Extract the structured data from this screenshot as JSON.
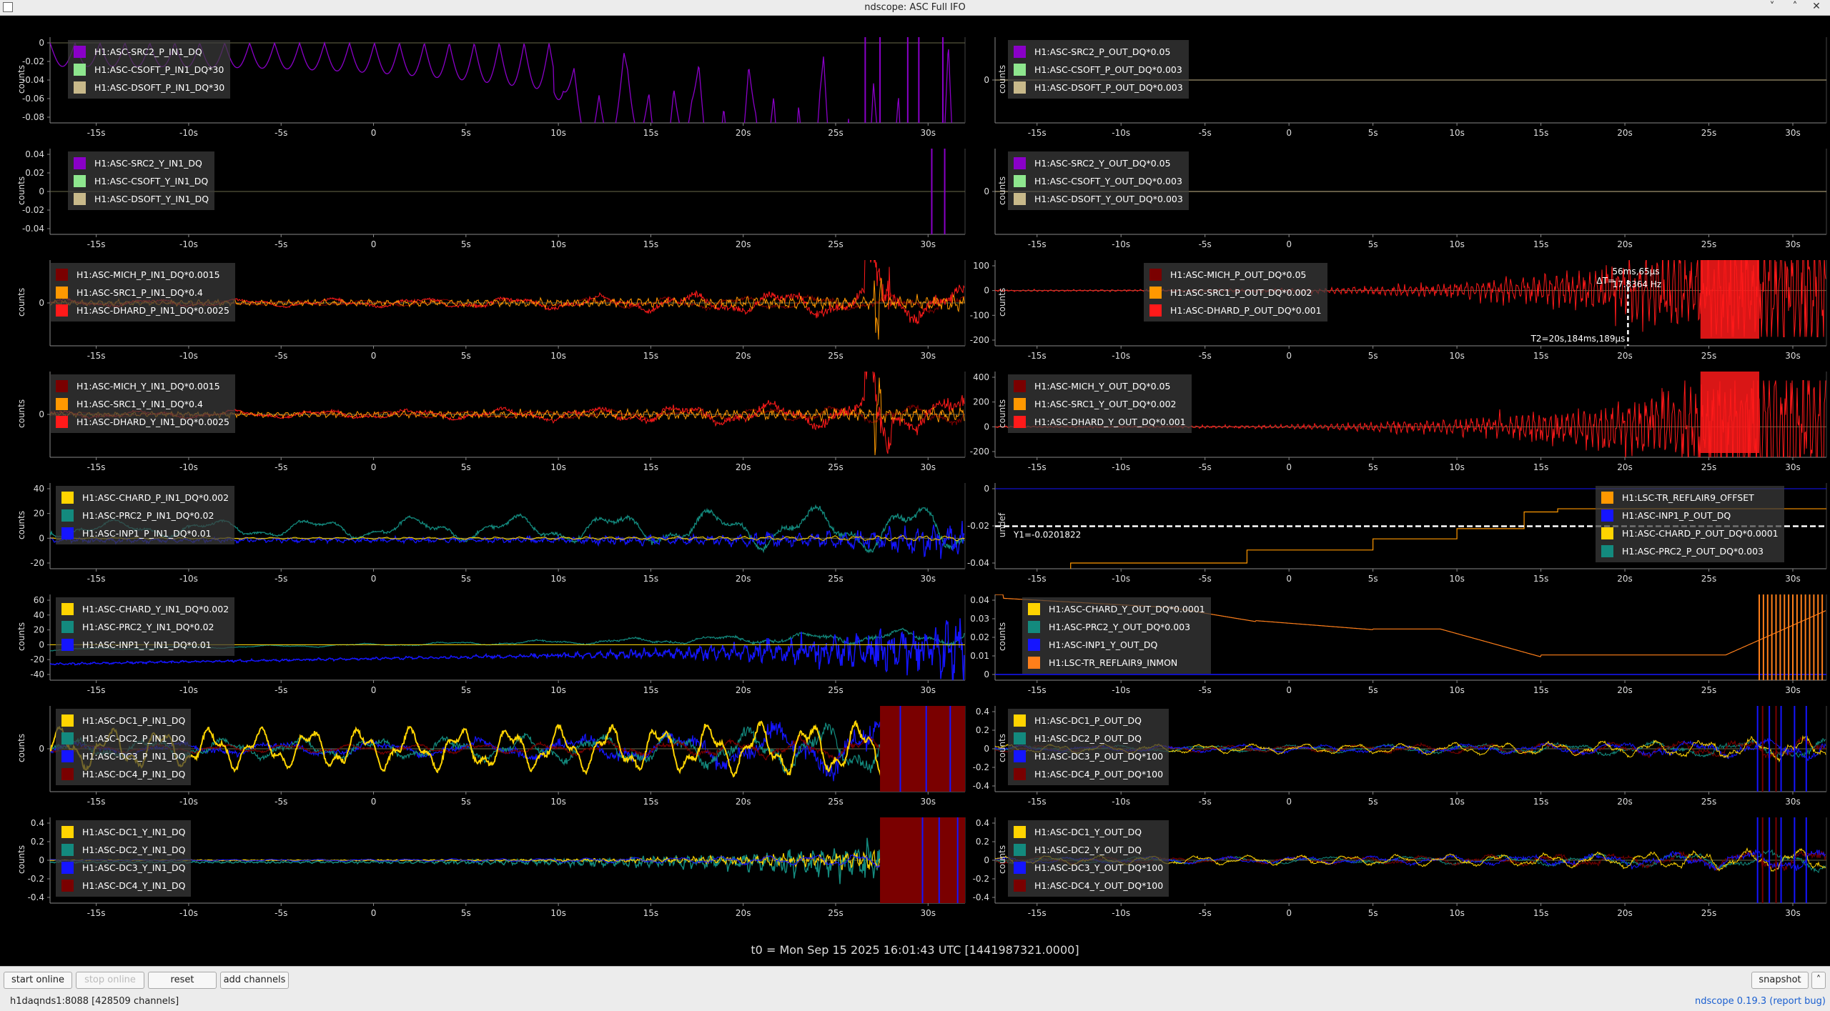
{
  "window": {
    "title": "ndscope: ASC Full IFO",
    "minimize_icon": "chevron-down-icon",
    "maximize_icon": "chevron-up-icon",
    "close_icon": "close-icon"
  },
  "time_axis": {
    "ticks": [
      "-15s",
      "-10s",
      "-5s",
      "0",
      "5s",
      "10s",
      "15s",
      "20s",
      "25s",
      "30s"
    ],
    "range": [
      -17.5,
      32
    ]
  },
  "t0_label": "t0 = Mon Sep 15 2025 16:01:43 UTC [1441987321.0000]",
  "colors": {
    "purple": "#8a00c8",
    "light_green": "#8ee68e",
    "khaki": "#c8b98a",
    "dark_red": "#7a0000",
    "orange": "#ff9800",
    "red": "#ff1a1a",
    "yellow": "#ffd400",
    "teal": "#138a7e",
    "blue": "#1515ff",
    "dark_orange": "#ff7f1a",
    "cursor": "#ffffff"
  },
  "panels": [
    {
      "id": "l1",
      "ylabel": "counts",
      "yticks": [
        "0",
        "-0.02",
        "-0.04",
        "-0.06",
        "-0.08"
      ],
      "legend": [
        {
          "label": "H1:ASC-SRC2_P_IN1_DQ",
          "color": "#8a00c8"
        },
        {
          "label": "H1:ASC-CSOFT_P_IN1_DQ*30",
          "color": "#8ee68e"
        },
        {
          "label": "H1:ASC-DSOFT_P_IN1_DQ*30",
          "color": "#c8b98a"
        }
      ]
    },
    {
      "id": "r1",
      "ylabel": "counts",
      "yticks": [
        "0"
      ],
      "legend": [
        {
          "label": "H1:ASC-SRC2_P_OUT_DQ*0.05",
          "color": "#8a00c8"
        },
        {
          "label": "H1:ASC-CSOFT_P_OUT_DQ*0.003",
          "color": "#8ee68e"
        },
        {
          "label": "H1:ASC-DSOFT_P_OUT_DQ*0.003",
          "color": "#c8b98a"
        }
      ]
    },
    {
      "id": "l2",
      "ylabel": "counts",
      "yticks": [
        "0.04",
        "0.02",
        "0",
        "-0.02",
        "-0.04"
      ],
      "legend": [
        {
          "label": "H1:ASC-SRC2_Y_IN1_DQ",
          "color": "#8a00c8"
        },
        {
          "label": "H1:ASC-CSOFT_Y_IN1_DQ",
          "color": "#8ee68e"
        },
        {
          "label": "H1:ASC-DSOFT_Y_IN1_DQ",
          "color": "#c8b98a"
        }
      ]
    },
    {
      "id": "r2",
      "ylabel": "counts",
      "yticks": [
        "0"
      ],
      "legend": [
        {
          "label": "H1:ASC-SRC2_Y_OUT_DQ*0.05",
          "color": "#8a00c8"
        },
        {
          "label": "H1:ASC-CSOFT_Y_OUT_DQ*0.003",
          "color": "#8ee68e"
        },
        {
          "label": "H1:ASC-DSOFT_Y_OUT_DQ*0.003",
          "color": "#c8b98a"
        }
      ]
    },
    {
      "id": "l3",
      "ylabel": "counts",
      "yticks": [
        "0"
      ],
      "legend": [
        {
          "label": "H1:ASC-MICH_P_IN1_DQ*0.0015",
          "color": "#7a0000"
        },
        {
          "label": "H1:ASC-SRC1_P_IN1_DQ*0.4",
          "color": "#ff9800"
        },
        {
          "label": "H1:ASC-DHARD_P_IN1_DQ*0.0025",
          "color": "#ff1a1a"
        }
      ]
    },
    {
      "id": "r3",
      "ylabel": "counts",
      "yticks": [
        "100",
        "0",
        "-100",
        "-200"
      ],
      "legend": [
        {
          "label": "H1:ASC-MICH_P_OUT_DQ*0.05",
          "color": "#7a0000"
        },
        {
          "label": "H1:ASC-SRC1_P_OUT_DQ*0.002",
          "color": "#ff9800"
        },
        {
          "label": "H1:ASC-DHARD_P_OUT_DQ*0.001",
          "color": "#ff1a1a"
        }
      ],
      "cursor": {
        "dt_label": "ΔT=",
        "dt_value": "56ms,65μs",
        "freq": "17.8364 Hz",
        "t2_label": "T2=20s,184ms,189μs",
        "t2": 20.184
      }
    },
    {
      "id": "l4",
      "ylabel": "counts",
      "yticks": [
        "0"
      ],
      "legend": [
        {
          "label": "H1:ASC-MICH_Y_IN1_DQ*0.0015",
          "color": "#7a0000"
        },
        {
          "label": "H1:ASC-SRC1_Y_IN1_DQ*0.4",
          "color": "#ff9800"
        },
        {
          "label": "H1:ASC-DHARD_Y_IN1_DQ*0.0025",
          "color": "#ff1a1a"
        }
      ]
    },
    {
      "id": "r4",
      "ylabel": "counts",
      "yticks": [
        "400",
        "200",
        "0",
        "-200"
      ],
      "legend": [
        {
          "label": "H1:ASC-MICH_Y_OUT_DQ*0.05",
          "color": "#7a0000"
        },
        {
          "label": "H1:ASC-SRC1_Y_OUT_DQ*0.002",
          "color": "#ff9800"
        },
        {
          "label": "H1:ASC-DHARD_Y_OUT_DQ*0.001",
          "color": "#ff1a1a"
        }
      ]
    },
    {
      "id": "l5",
      "ylabel": "counts",
      "yticks": [
        "40",
        "20",
        "0",
        "-20"
      ],
      "legend": [
        {
          "label": "H1:ASC-CHARD_P_IN1_DQ*0.002",
          "color": "#ffd400"
        },
        {
          "label": "H1:ASC-PRC2_P_IN1_DQ*0.02",
          "color": "#138a7e"
        },
        {
          "label": "H1:ASC-INP1_P_IN1_DQ*0.01",
          "color": "#1515ff"
        }
      ]
    },
    {
      "id": "r5",
      "ylabel": "undef",
      "yticks": [
        "0",
        "-0.02",
        "-0.04"
      ],
      "legend": [
        {
          "label": "H1:LSC-TR_REFLAIR9_OFFSET",
          "color": "#ff9800"
        },
        {
          "label": "H1:ASC-INP1_P_OUT_DQ",
          "color": "#1515ff"
        },
        {
          "label": "H1:ASC-CHARD_P_OUT_DQ*0.0001",
          "color": "#ffd400"
        },
        {
          "label": "H1:ASC-PRC2_P_OUT_DQ*0.003",
          "color": "#138a7e"
        }
      ],
      "cursor": {
        "y1_label": "Y1=-0.0201822",
        "y1": -0.0201822
      }
    },
    {
      "id": "l6",
      "ylabel": "counts",
      "yticks": [
        "60",
        "40",
        "20",
        "0",
        "-20",
        "-40"
      ],
      "legend": [
        {
          "label": "H1:ASC-CHARD_Y_IN1_DQ*0.002",
          "color": "#ffd400"
        },
        {
          "label": "H1:ASC-PRC2_Y_IN1_DQ*0.02",
          "color": "#138a7e"
        },
        {
          "label": "H1:ASC-INP1_Y_IN1_DQ*0.01",
          "color": "#1515ff"
        }
      ]
    },
    {
      "id": "r6",
      "ylabel": "counts",
      "yticks": [
        "0.04",
        "0.03",
        "0.02",
        "0.01",
        "0"
      ],
      "legend": [
        {
          "label": "H1:ASC-CHARD_Y_OUT_DQ*0.0001",
          "color": "#ffd400"
        },
        {
          "label": "H1:ASC-PRC2_Y_OUT_DQ*0.003",
          "color": "#138a7e"
        },
        {
          "label": "H1:ASC-INP1_Y_OUT_DQ",
          "color": "#1515ff"
        },
        {
          "label": "H1:LSC-TR_REFLAIR9_INMON",
          "color": "#ff7f1a"
        }
      ]
    },
    {
      "id": "l7",
      "ylabel": "counts",
      "yticks": [
        "0"
      ],
      "legend": [
        {
          "label": "H1:ASC-DC1_P_IN1_DQ",
          "color": "#ffd400"
        },
        {
          "label": "H1:ASC-DC2_P_IN1_DQ",
          "color": "#138a7e"
        },
        {
          "label": "H1:ASC-DC3_P_IN1_DQ",
          "color": "#1515ff"
        },
        {
          "label": "H1:ASC-DC4_P_IN1_DQ",
          "color": "#7a0000"
        }
      ]
    },
    {
      "id": "r7",
      "ylabel": "counts",
      "yticks": [
        "0.4",
        "0.2",
        "0",
        "-0.2",
        "-0.4"
      ],
      "legend": [
        {
          "label": "H1:ASC-DC1_P_OUT_DQ",
          "color": "#ffd400"
        },
        {
          "label": "H1:ASC-DC2_P_OUT_DQ",
          "color": "#138a7e"
        },
        {
          "label": "H1:ASC-DC3_P_OUT_DQ*100",
          "color": "#1515ff"
        },
        {
          "label": "H1:ASC-DC4_P_OUT_DQ*100",
          "color": "#7a0000"
        }
      ]
    },
    {
      "id": "l8",
      "ylabel": "counts",
      "yticks": [
        "0.4",
        "0.2",
        "0",
        "-0.2",
        "-0.4"
      ],
      "legend": [
        {
          "label": "H1:ASC-DC1_Y_IN1_DQ",
          "color": "#ffd400"
        },
        {
          "label": "H1:ASC-DC2_Y_IN1_DQ",
          "color": "#138a7e"
        },
        {
          "label": "H1:ASC-DC3_Y_IN1_DQ",
          "color": "#1515ff"
        },
        {
          "label": "H1:ASC-DC4_Y_IN1_DQ",
          "color": "#7a0000"
        }
      ]
    },
    {
      "id": "r8",
      "ylabel": "counts",
      "yticks": [
        "0.4",
        "0.2",
        "0",
        "-0.2",
        "-0.4"
      ],
      "legend": [
        {
          "label": "H1:ASC-DC1_Y_OUT_DQ",
          "color": "#ffd400"
        },
        {
          "label": "H1:ASC-DC2_Y_OUT_DQ",
          "color": "#138a7e"
        },
        {
          "label": "H1:ASC-DC3_Y_OUT_DQ*100",
          "color": "#1515ff"
        },
        {
          "label": "H1:ASC-DC4_Y_OUT_DQ*100",
          "color": "#7a0000"
        }
      ]
    }
  ],
  "toolbar": {
    "start_online": "start online",
    "stop_online": "stop online",
    "reset": "reset",
    "add_channels": "add channels",
    "snapshot": "snapshot",
    "status": "h1daqnds1:8088  [428509 channels]",
    "version": "ndscope 0.19.3",
    "report_bug": "(report bug)"
  }
}
